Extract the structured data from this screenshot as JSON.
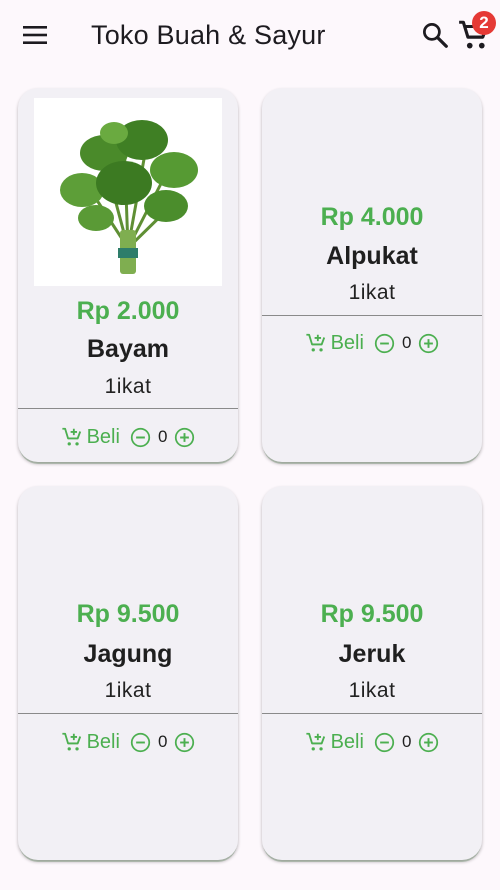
{
  "appbar": {
    "title": "Toko Buah & Sayur",
    "menu_icon": "menu-icon",
    "search_icon": "search-icon",
    "cart_icon": "shopping-cart-icon",
    "cart_count": "2"
  },
  "accent_color": "#4caf50",
  "badge_color": "#e53935",
  "products": [
    {
      "price": "Rp 2.000",
      "name": "Bayam",
      "unit": "1ikat",
      "buy_label": "Beli",
      "qty": "0",
      "image": "spinach-photo"
    },
    {
      "price": "Rp 4.000",
      "name": "Alpukat",
      "unit": "1ikat",
      "buy_label": "Beli",
      "qty": "0"
    },
    {
      "price": "Rp 9.500",
      "name": "Jagung",
      "unit": "1ikat",
      "buy_label": "Beli",
      "qty": "0"
    },
    {
      "price": "Rp 9.500",
      "name": "Jeruk",
      "unit": "1ikat",
      "buy_label": "Beli",
      "qty": "0"
    }
  ]
}
